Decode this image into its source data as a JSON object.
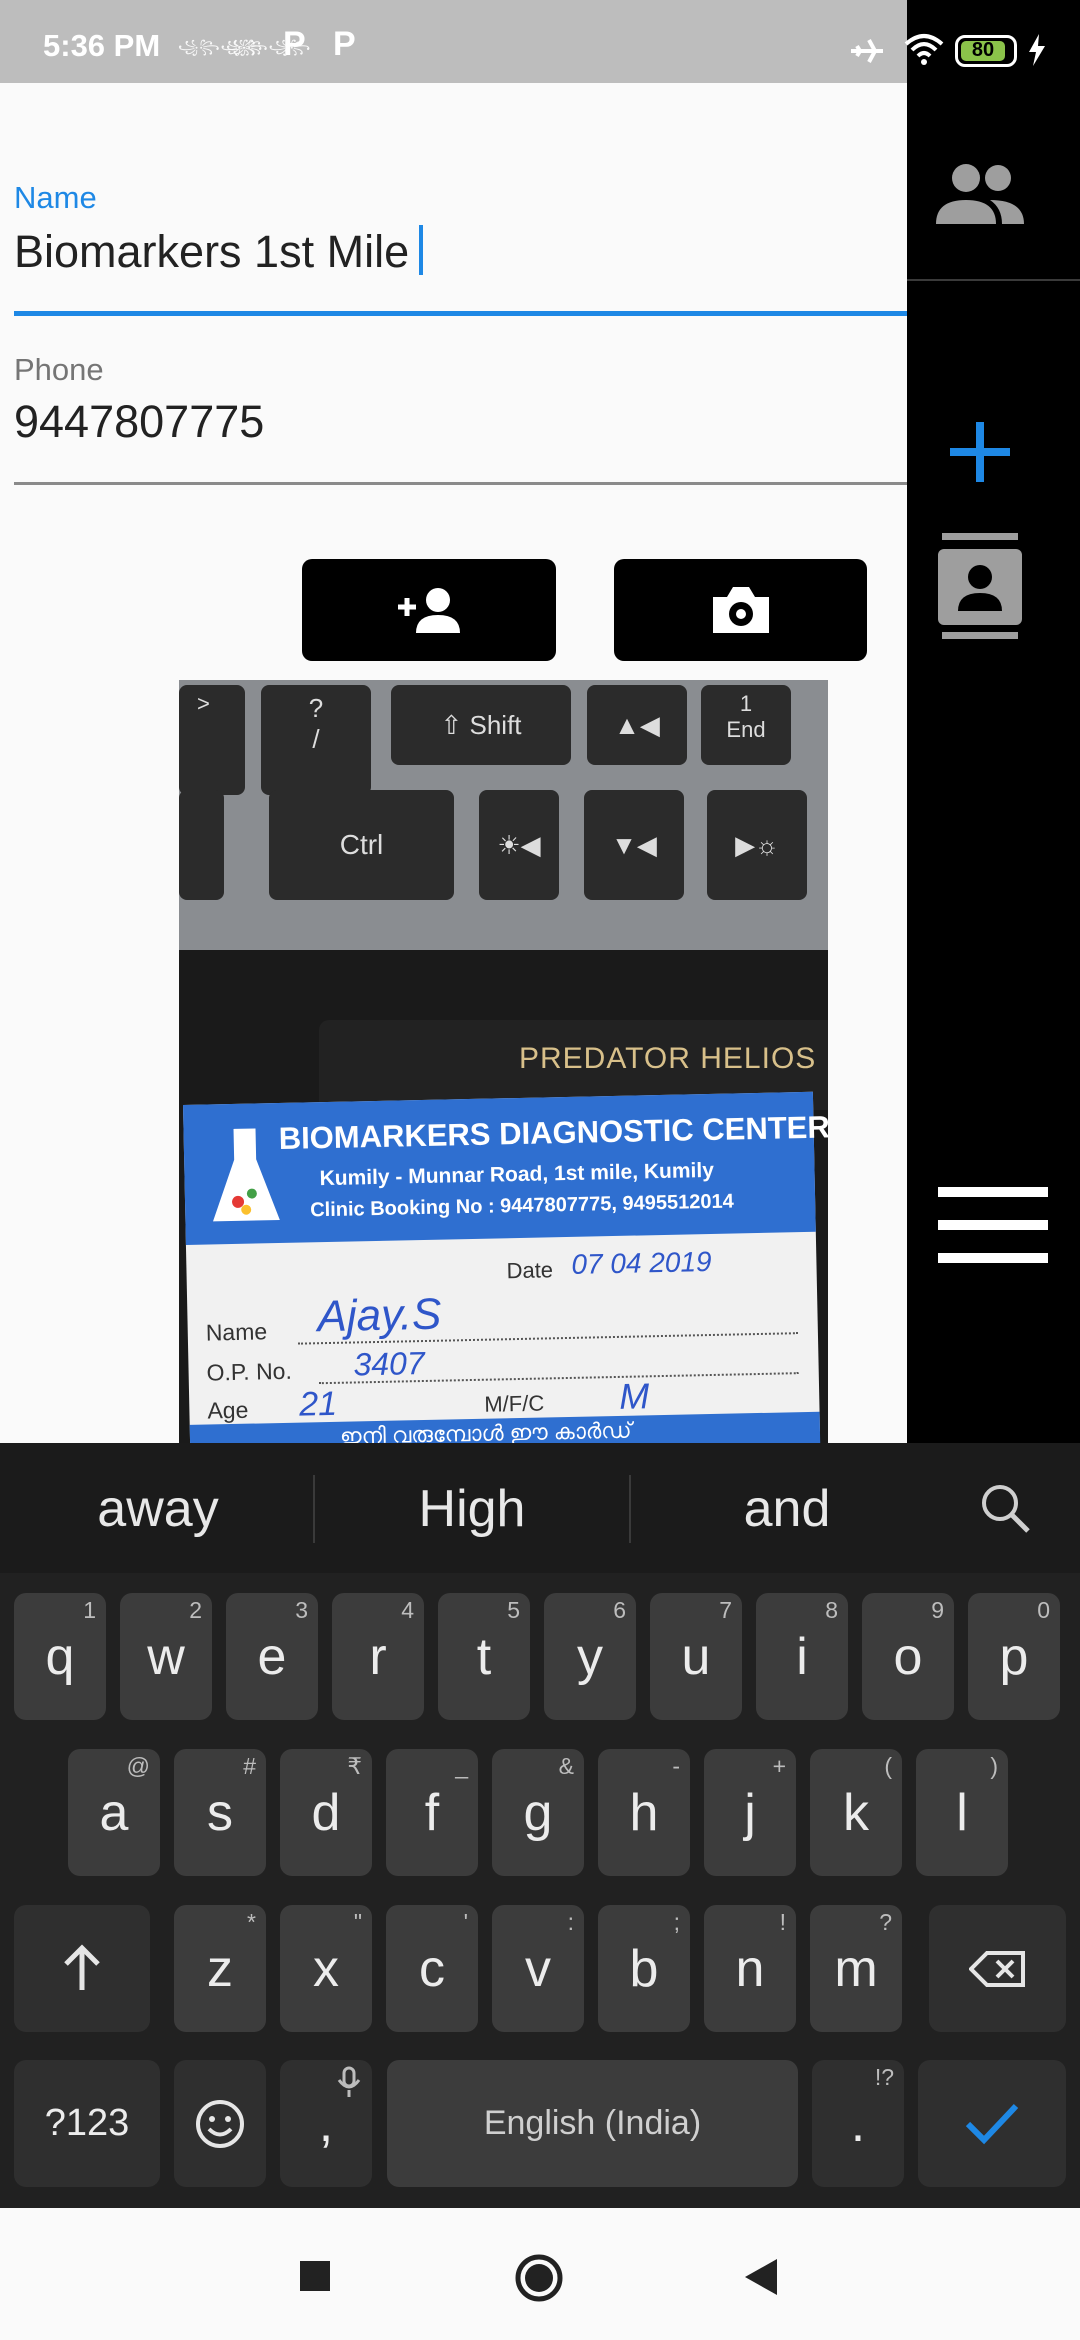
{
  "status_bar": {
    "time": "5:36 PM",
    "notif_1": "꧁꧂꧁꧂",
    "notif_2": "꧁꧂꧁꧂",
    "p1": "P",
    "p2": "P",
    "battery": "80"
  },
  "form": {
    "name_label": "Name",
    "name_value": "Biomarkers 1st Mile",
    "phone_label": "Phone",
    "phone_value": "9447807775"
  },
  "photo": {
    "keys": [
      "Shift",
      "Ctrl",
      "1",
      "End",
      ">",
      "?",
      "/"
    ],
    "laptop_text": "PREDATOR HELIOS",
    "card_title": "BIOMARKERS DIAGNOSTIC CENTER",
    "card_address": "Kumily - Munnar Road, 1st mile, Kumily",
    "card_booking": "Clinic Booking No : 9447807775, 9495512014",
    "card_date_label": "Date",
    "card_date_value": "07 04 2019",
    "card_name_label": "Name",
    "card_name_value": "Ajay.S",
    "card_op_label": "O.P. No.",
    "card_op_value": "3407",
    "card_age_label": "Age",
    "card_age_value": "21",
    "card_mfc_label": "M/F/C",
    "card_mfc_value": "M",
    "card_footer": "ഇനി വരുമ്പോൾ ഈ കാർഡ്"
  },
  "keyboard": {
    "suggestions": [
      "away",
      "High",
      "and"
    ],
    "row1": [
      {
        "k": "q",
        "h": "1"
      },
      {
        "k": "w",
        "h": "2"
      },
      {
        "k": "e",
        "h": "3"
      },
      {
        "k": "r",
        "h": "4"
      },
      {
        "k": "t",
        "h": "5"
      },
      {
        "k": "y",
        "h": "6"
      },
      {
        "k": "u",
        "h": "7"
      },
      {
        "k": "i",
        "h": "8"
      },
      {
        "k": "o",
        "h": "9"
      },
      {
        "k": "p",
        "h": "0"
      }
    ],
    "row2": [
      {
        "k": "a",
        "h": "@"
      },
      {
        "k": "s",
        "h": "#"
      },
      {
        "k": "d",
        "h": "₹"
      },
      {
        "k": "f",
        "h": "_"
      },
      {
        "k": "g",
        "h": "&"
      },
      {
        "k": "h",
        "h": "-"
      },
      {
        "k": "j",
        "h": "+"
      },
      {
        "k": "k",
        "h": "("
      },
      {
        "k": "l",
        "h": ")"
      }
    ],
    "row3": [
      {
        "k": "z",
        "h": "*"
      },
      {
        "k": "x",
        "h": "\""
      },
      {
        "k": "c",
        "h": "'"
      },
      {
        "k": "v",
        "h": ":"
      },
      {
        "k": "b",
        "h": ";"
      },
      {
        "k": "n",
        "h": "!"
      },
      {
        "k": "m",
        "h": "?"
      }
    ],
    "symbols_label": "?123",
    "comma": ",",
    "space_label": "English (India)",
    "period": ".",
    "period_hint": "!?"
  },
  "colors": {
    "accent": "#1e88e5",
    "card_blue": "#2f6fd0"
  }
}
